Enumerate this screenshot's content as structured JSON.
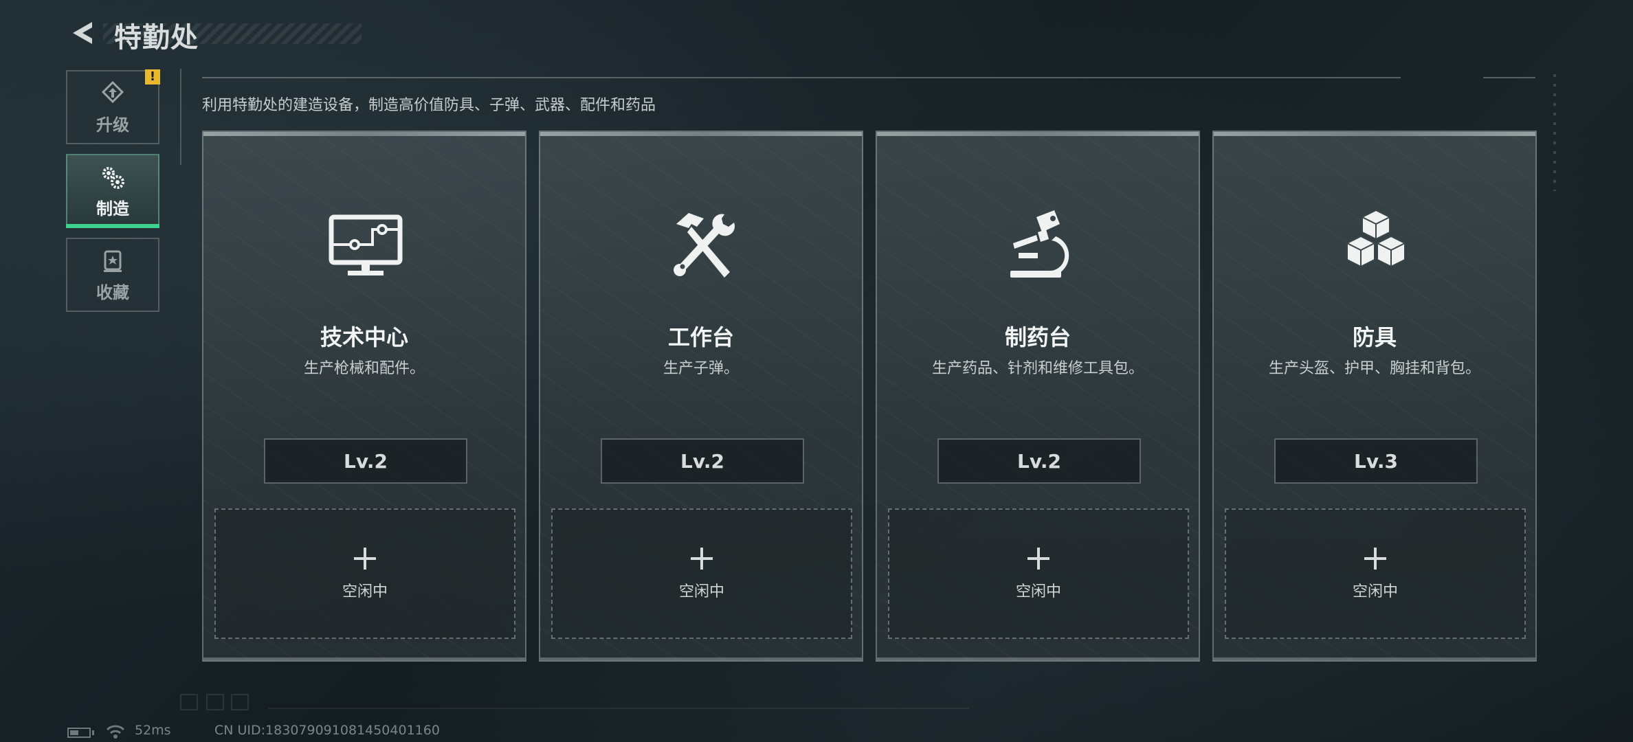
{
  "header": {
    "title": "特勤处",
    "description": "利用特勤处的建造设备，制造高价值防具、子弹、武器、配件和药品"
  },
  "sidebar": {
    "items": [
      {
        "label": "升级",
        "icon": "upgrade-icon",
        "badge": "!"
      },
      {
        "label": "制造",
        "icon": "gears-icon",
        "active": true
      },
      {
        "label": "收藏",
        "icon": "collection-icon"
      }
    ]
  },
  "cards": [
    {
      "name": "技术中心",
      "description": "生产枪械和配件。",
      "level": "Lv.2",
      "slot_status": "空闲中",
      "icon": "monitor-circuit-icon"
    },
    {
      "name": "工作台",
      "description": "生产子弹。",
      "level": "Lv.2",
      "slot_status": "空闲中",
      "icon": "hammer-wrench-icon"
    },
    {
      "name": "制药台",
      "description": "生产药品、针剂和维修工具包。",
      "level": "Lv.2",
      "slot_status": "空闲中",
      "icon": "microscope-icon"
    },
    {
      "name": "防具",
      "description": "生产头盔、护甲、胸挂和背包。",
      "level": "Lv.3",
      "slot_status": "空闲中",
      "icon": "cubes-icon"
    }
  ],
  "status_bar": {
    "ping": "52ms",
    "uid": "CN UID:183079091081450401160"
  },
  "colors": {
    "accent_active": "#3ed28e",
    "alert_badge": "#e8b92e",
    "background": "#1a252a"
  }
}
